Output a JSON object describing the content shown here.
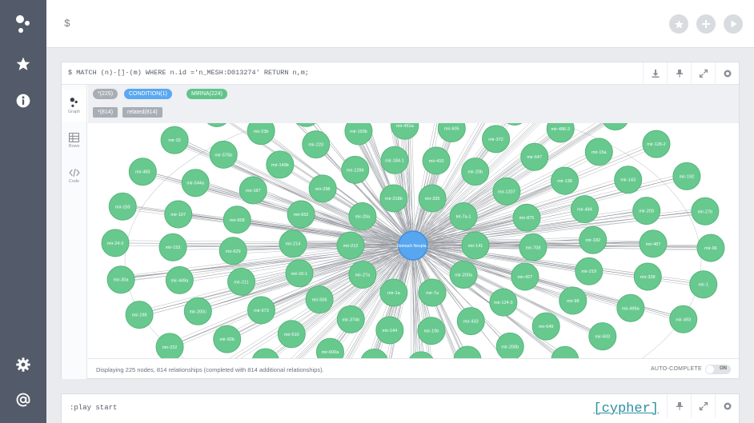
{
  "editor": {
    "prompt": "$"
  },
  "frame": {
    "query": "$ MATCH (n)-[]-(m) WHERE n.id ='n_MESH:D013274' RETURN n,m;",
    "views": [
      "Graph",
      "Rows",
      "Code"
    ],
    "labels": [
      {
        "text": "*(225)",
        "style": "grey"
      },
      {
        "text": "CONDITION(1)",
        "style": "blue"
      },
      {
        "text": "MIRNA(224)",
        "style": "green"
      }
    ],
    "relationships": [
      {
        "text": "*(814)"
      },
      {
        "text": "related(814)"
      }
    ],
    "status": "Displaying 225 nodes, 814 relationships (completed with 814 additional relationships).",
    "autocomplete": {
      "label": "AUTO-COMPLETE",
      "state": "ON"
    }
  },
  "graph": {
    "center": {
      "label": "Stomach Neopla..."
    },
    "nodes": [
      "mir-141",
      "mir-200a",
      "mir-7a",
      "mir-1a",
      "mir-27a",
      "mir-212",
      "mir-20a",
      "mir-218b",
      "mir-335",
      "let-7a-1",
      "mir-427",
      "mir-124-3",
      "mir-433",
      "mir-10b",
      "mir-144",
      "mir-374b",
      "mir-506",
      "mir-16-1",
      "mir-214",
      "mir-652",
      "mir-298",
      "mir-1284",
      "mir-184-1",
      "mir-410",
      "mir-20b",
      "mir-1207",
      "mir-875",
      "mir-708",
      "mir-649",
      "mir-200b",
      "mir-4729",
      "mir-184",
      "mir-195",
      "mir-600a",
      "mir-510",
      "mir-673",
      "mir-211",
      "mir-629",
      "mir-658",
      "mir-187",
      "mir-149b",
      "mir-223",
      "mir-193b",
      "mir-451a",
      "mir-605",
      "mir-372",
      "mir-647",
      "mir-138",
      "mir-484",
      "mir-182",
      "mir-219",
      "mir-98",
      "let-7g",
      "mir-126",
      "mir-575",
      "mir-942",
      "mir-825",
      "mir-421",
      "mir-92b",
      "mir-200c",
      "mir-449a",
      "mir-153",
      "mir-107",
      "mir-544a",
      "mir-575b",
      "mir-23b",
      "mir-382",
      "mir-186",
      "mir-95",
      "mir-199",
      "mir-18a",
      "mir-486-3",
      "mir-15a",
      "mir-143",
      "mir-203",
      "mir-487",
      "mir-328",
      "mir-499a",
      "mir-603",
      "mir-152",
      "mir-408",
      "mir-29a",
      "mir-302",
      "mir-495",
      "mir-128-1",
      "mir-222",
      "mir-198",
      "mir-30a",
      "mir-24-3",
      "mir-150",
      "mir-483",
      "mir-32",
      "mir-490",
      "mir-30b",
      "mir-574",
      "mir-26a-1",
      "mir-204",
      "mir-130",
      "mir-22",
      "mir-197",
      "mir-128-2",
      "mir-192",
      "mir-27b",
      "mir-96",
      "mir-1",
      "mir-493"
    ]
  },
  "frame2": {
    "query": ":play start",
    "tag": "[cypher]"
  }
}
